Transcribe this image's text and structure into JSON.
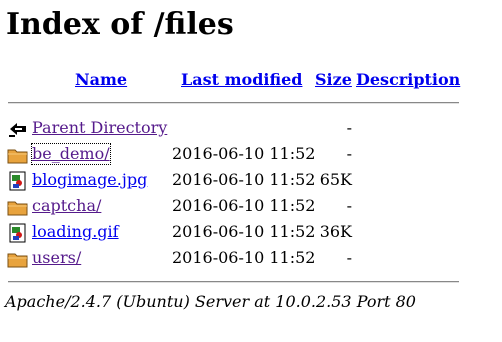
{
  "page_title": "Index of /files",
  "columns": {
    "name": "Name",
    "last_modified": "Last modified",
    "size": "Size",
    "description": "Description"
  },
  "rows": [
    {
      "name": "Parent Directory",
      "modified": "",
      "size": "-",
      "icon": "back-icon"
    },
    {
      "name": "be_demo/",
      "modified": "2016-06-10 11:52",
      "size": "-",
      "icon": "folder-icon"
    },
    {
      "name": "blogimage.jpg",
      "modified": "2016-06-10 11:52",
      "size": "65K",
      "icon": "image-icon"
    },
    {
      "name": "captcha/",
      "modified": "2016-06-10 11:52",
      "size": "-",
      "icon": "folder-icon"
    },
    {
      "name": "loading.gif",
      "modified": "2016-06-10 11:52",
      "size": "36K",
      "icon": "image-icon"
    },
    {
      "name": "users/",
      "modified": "2016-06-10 11:52",
      "size": "-",
      "icon": "folder-icon"
    }
  ],
  "footer": "Apache/2.4.7 (Ubuntu) Server at 10.0.2.53 Port 80",
  "colors": {
    "link": "#0000ee",
    "visited": "#551a8b",
    "folder": "#e8a33d"
  }
}
